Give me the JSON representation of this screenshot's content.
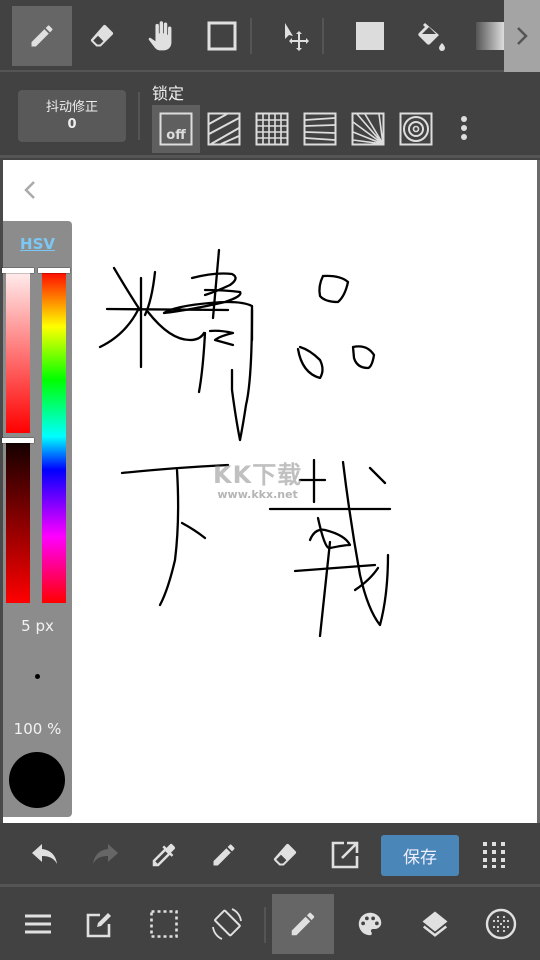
{
  "top_toolbar": {
    "tools": [
      {
        "name": "pen",
        "icon": "pencil-icon",
        "active": true
      },
      {
        "name": "eraser",
        "icon": "eraser-icon",
        "active": false
      },
      {
        "name": "hand",
        "icon": "hand-icon",
        "active": false
      },
      {
        "name": "rectangle",
        "icon": "rectangle-outline-icon",
        "active": false
      },
      {
        "name": "move",
        "icon": "select-move-icon",
        "active": false
      },
      {
        "name": "fill-shape",
        "icon": "filled-square-icon",
        "active": false
      },
      {
        "name": "bucket",
        "icon": "paint-bucket-icon",
        "active": false
      },
      {
        "name": "gradient",
        "icon": "gradient-icon",
        "active": false
      }
    ],
    "scroll_right_icon": "chevron-right-icon"
  },
  "sub_toolbar": {
    "stabilizer_label": "抖动修正",
    "stabilizer_value": "0",
    "lock_label": "锁定",
    "lock_options": [
      {
        "name": "off",
        "label": "off",
        "active": true
      },
      {
        "name": "parallel",
        "icon": "parallel-lines-icon"
      },
      {
        "name": "grid",
        "icon": "grid-icon"
      },
      {
        "name": "perspective-horizontal",
        "icon": "vanishing-lines-icon"
      },
      {
        "name": "radial",
        "icon": "radial-lines-icon"
      },
      {
        "name": "concentric",
        "icon": "concentric-circles-icon"
      }
    ],
    "more_icon": "more-vertical-icon"
  },
  "color_panel": {
    "mode_tab": "HSV",
    "saturation_level": 1.0,
    "value_level": 0.0,
    "hue_level": 0.0,
    "brush_size": "5 px",
    "opacity": "100 %",
    "current_color": "#000000",
    "accent": "#7cc8f4"
  },
  "canvas": {
    "watermark_title": "KK下载",
    "watermark_url": "www.kkx.net"
  },
  "action_bar": {
    "undo_icon": "undo-icon",
    "redo_icon": "redo-icon",
    "eyedropper_icon": "eyedropper-icon",
    "pen_icon": "pencil-icon",
    "eraser_icon": "eraser-icon",
    "export_icon": "external-link-icon",
    "save_label": "保存",
    "save_color": "#4a87b8",
    "menu_icon": "grid-dots-icon"
  },
  "bottom_nav": {
    "items": [
      {
        "name": "menu",
        "icon": "hamburger-icon"
      },
      {
        "name": "edit",
        "icon": "edit-square-icon"
      },
      {
        "name": "selection",
        "icon": "dotted-selection-icon"
      },
      {
        "name": "rotate",
        "icon": "rotate-device-icon"
      },
      {
        "name": "brush",
        "icon": "pencil-icon",
        "active": true
      },
      {
        "name": "color",
        "icon": "palette-icon"
      },
      {
        "name": "layers",
        "icon": "layers-icon"
      },
      {
        "name": "materials",
        "icon": "dotted-circle-icon"
      }
    ]
  }
}
